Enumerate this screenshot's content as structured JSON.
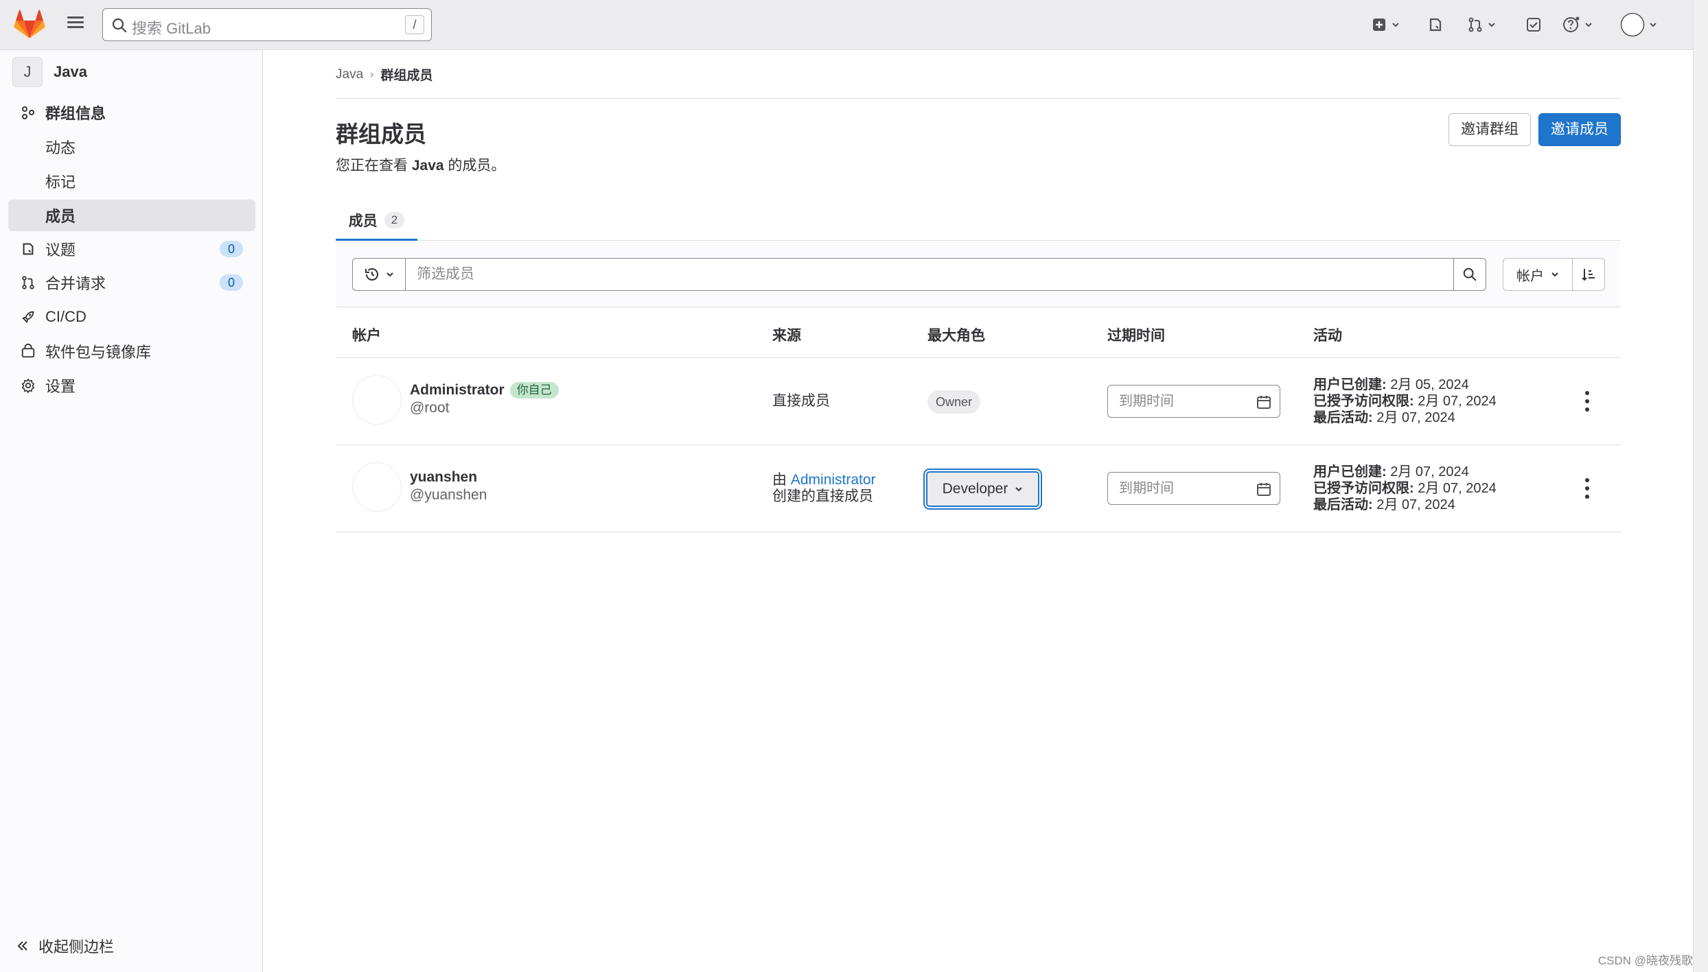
{
  "topbar": {
    "search_placeholder": "搜索 GitLab",
    "search_shortcut": "/"
  },
  "sidebar": {
    "context_avatar": "J",
    "context_name": "Java",
    "items": [
      {
        "label": "群组信息",
        "icon": "group-icon"
      },
      {
        "label": "动态"
      },
      {
        "label": "标记"
      },
      {
        "label": "成员"
      },
      {
        "label": "议题",
        "icon": "issues-icon",
        "count": "0"
      },
      {
        "label": "合并请求",
        "icon": "merge-request-icon",
        "count": "0"
      },
      {
        "label": "CI/CD",
        "icon": "rocket-icon"
      },
      {
        "label": "软件包与镜像库",
        "icon": "package-icon"
      },
      {
        "label": "设置",
        "icon": "gear-icon"
      }
    ],
    "collapse_label": "收起侧边栏"
  },
  "breadcrumb": {
    "parent": "Java",
    "current": "群组成员"
  },
  "page": {
    "title": "群组成员",
    "subtitle_prefix": "您正在查看",
    "subtitle_group": "Java",
    "subtitle_suffix": "的成员。",
    "invite_group_label": "邀请群组",
    "invite_member_label": "邀请成员"
  },
  "tabs": [
    {
      "label": "成员",
      "count": "2"
    }
  ],
  "filter": {
    "placeholder": "筛选成员",
    "sort_label": "帐户"
  },
  "table": {
    "headers": [
      "帐户",
      "来源",
      "最大角色",
      "过期时间",
      "活动"
    ],
    "rows": [
      {
        "name": "Administrator",
        "badge": "你自己",
        "handle": "@root",
        "source": "直接成员",
        "role": "Owner",
        "expiry_placeholder": "到期时间",
        "created_label": "用户已创建:",
        "created": "2月 05, 2024",
        "access_label": "已授予访问权限:",
        "access": "2月 07, 2024",
        "last_label": "最后活动:",
        "last": "2月 07, 2024"
      },
      {
        "name": "yuanshen",
        "handle": "@yuanshen",
        "source_prefix": "由",
        "source_link": "Administrator",
        "source_suffix": "创建的直接成员",
        "role": "Developer",
        "expiry_placeholder": "到期时间",
        "created_label": "用户已创建:",
        "created": "2月 07, 2024",
        "access_label": "已授予访问权限:",
        "access": "2月 07, 2024",
        "last_label": "最后活动:",
        "last": "2月 07, 2024"
      }
    ]
  },
  "watermark": "CSDN @晓夜残歌",
  "colors": {
    "primary": "#1f75cb",
    "sidebar_bg": "#fbfafd",
    "topbar_bg": "#ececef",
    "badge_green": "#c3e6cd"
  }
}
